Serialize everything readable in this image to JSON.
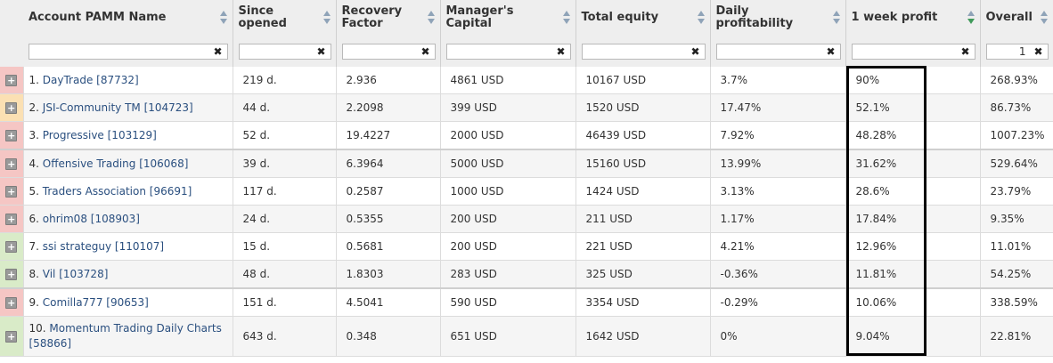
{
  "columns": [
    {
      "label": "Account PAMM Name"
    },
    {
      "label": "Since opened"
    },
    {
      "label": "Recovery Factor"
    },
    {
      "label": "Manager's Capital"
    },
    {
      "label": "Total equity"
    },
    {
      "label": "Daily profitability"
    },
    {
      "label": "1 week profit",
      "sorted": "desc"
    },
    {
      "label": "Overall"
    }
  ],
  "filters": {
    "overall_value": "1",
    "clear_glyph": "✖"
  },
  "expand_glyph": "+",
  "row_flag_colors": {
    "red": "#f5c6c4",
    "orange": "#fbe0b3",
    "green": "#d9ebc8"
  },
  "rows": [
    {
      "flag": "red",
      "num": "1.",
      "name": "DayTrade [87732]",
      "since": "219 d.",
      "recovery": "2.936",
      "capital": "4861 USD",
      "equity": "10167 USD",
      "daily": "3.7%",
      "week": "90%",
      "overall": "268.93%"
    },
    {
      "flag": "orange",
      "num": "2.",
      "name": "JSI-Community TM [104723]",
      "since": "44 d.",
      "recovery": "2.2098",
      "capital": "399 USD",
      "equity": "1520 USD",
      "daily": "17.47%",
      "week": "52.1%",
      "overall": "86.73%"
    },
    {
      "flag": "red",
      "num": "3.",
      "name": "Progressive [103129]",
      "since": "52 d.",
      "recovery": "19.4227",
      "capital": "2000 USD",
      "equity": "46439 USD",
      "daily": "7.92%",
      "week": "48.28%",
      "overall": "1007.23%"
    },
    {
      "flag": "red",
      "num": "4.",
      "name": "Offensive Trading [106068]",
      "since": "39 d.",
      "recovery": "6.3964",
      "capital": "5000 USD",
      "equity": "15160 USD",
      "daily": "13.99%",
      "week": "31.62%",
      "overall": "529.64%"
    },
    {
      "flag": "red",
      "num": "5.",
      "name": "Traders Association [96691]",
      "since": "117 d.",
      "recovery": "0.2587",
      "capital": "1000 USD",
      "equity": "1424 USD",
      "daily": "3.13%",
      "week": "28.6%",
      "overall": "23.79%"
    },
    {
      "flag": "red",
      "num": "6.",
      "name": "ohrim08 [108903]",
      "since": "24 d.",
      "recovery": "0.5355",
      "capital": "200 USD",
      "equity": "211 USD",
      "daily": "1.17%",
      "week": "17.84%",
      "overall": "9.35%"
    },
    {
      "flag": "green",
      "num": "7.",
      "name": "ssi strateguy [110107]",
      "since": "15 d.",
      "recovery": "0.5681",
      "capital": "200 USD",
      "equity": "221 USD",
      "daily": "4.21%",
      "week": "12.96%",
      "overall": "11.01%"
    },
    {
      "flag": "green",
      "num": "8.",
      "name": "Vil [103728]",
      "since": "48 d.",
      "recovery": "1.8303",
      "capital": "283 USD",
      "equity": "325 USD",
      "daily": "-0.36%",
      "week": "11.81%",
      "overall": "54.25%"
    },
    {
      "flag": "red",
      "num": "9.",
      "name": "Comilla777 [90653]",
      "since": "151 d.",
      "recovery": "4.5041",
      "capital": "590 USD",
      "equity": "3354 USD",
      "daily": "-0.29%",
      "week": "10.06%",
      "overall": "338.59%"
    },
    {
      "flag": "green",
      "num": "10.",
      "name": "Momentum Trading Daily Charts [58866]",
      "since": "643 d.",
      "recovery": "0.348",
      "capital": "651 USD",
      "equity": "1642 USD",
      "daily": "0%",
      "week": "9.04%",
      "overall": "22.81%"
    }
  ]
}
